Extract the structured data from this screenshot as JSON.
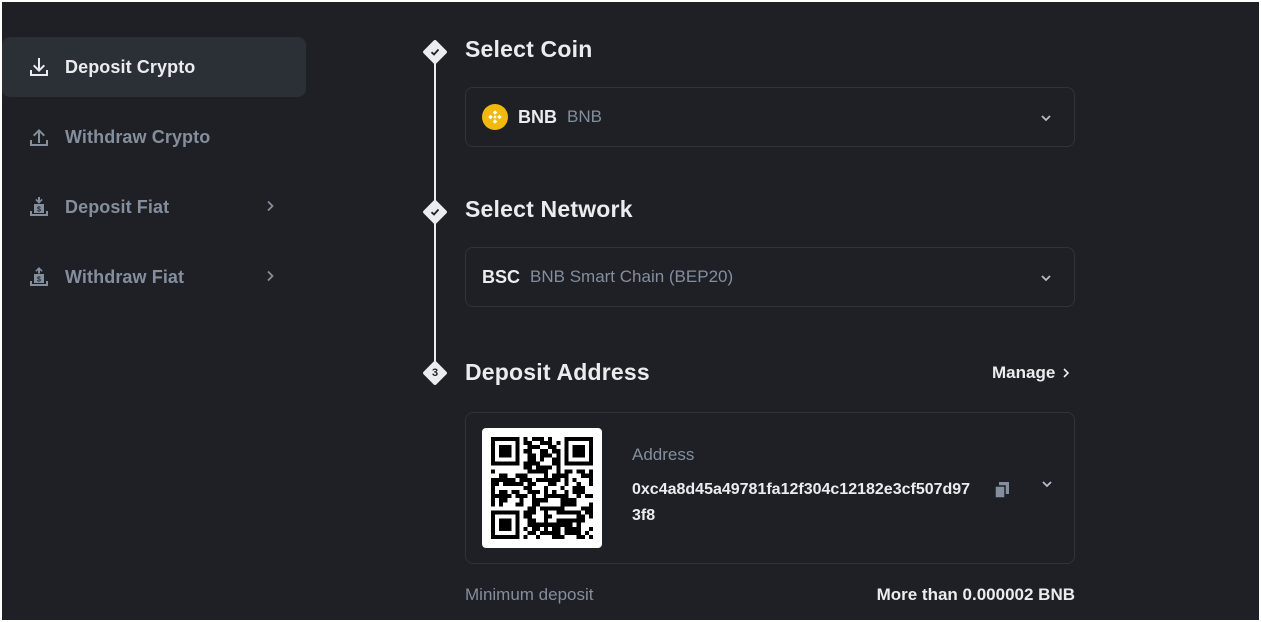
{
  "sidebar": {
    "items": [
      {
        "label": "Deposit Crypto",
        "active": true,
        "icon": "download-icon"
      },
      {
        "label": "Withdraw Crypto",
        "active": false,
        "icon": "upload-icon"
      },
      {
        "label": "Deposit Fiat",
        "active": false,
        "icon": "deposit-fiat-icon",
        "has_submenu": true
      },
      {
        "label": "Withdraw Fiat",
        "active": false,
        "icon": "withdraw-fiat-icon",
        "has_submenu": true
      }
    ]
  },
  "steps": {
    "coin": {
      "title": "Select Coin",
      "status": "done"
    },
    "network": {
      "title": "Select Network",
      "status": "done"
    },
    "address": {
      "title": "Deposit Address",
      "number": "3"
    }
  },
  "coin_select": {
    "symbol": "BNB",
    "name": "BNB",
    "icon": "bnb-coin-icon"
  },
  "network_select": {
    "code": "BSC",
    "name": "BNB Smart Chain (BEP20)"
  },
  "manage_label": "Manage",
  "deposit_address": {
    "label": "Address",
    "value": "0xc4a8d45a49781fa12f304c12182e3cf507d973f8"
  },
  "minimum_deposit": {
    "label": "Minimum deposit",
    "value": "More than 0.000002 BNB"
  },
  "colors": {
    "background": "#1e2026",
    "panel_active": "#2b2f36",
    "border": "#2f333b",
    "text_primary": "#eaecef",
    "text_secondary": "#848e9c",
    "brand_yellow": "#f0b90b"
  }
}
